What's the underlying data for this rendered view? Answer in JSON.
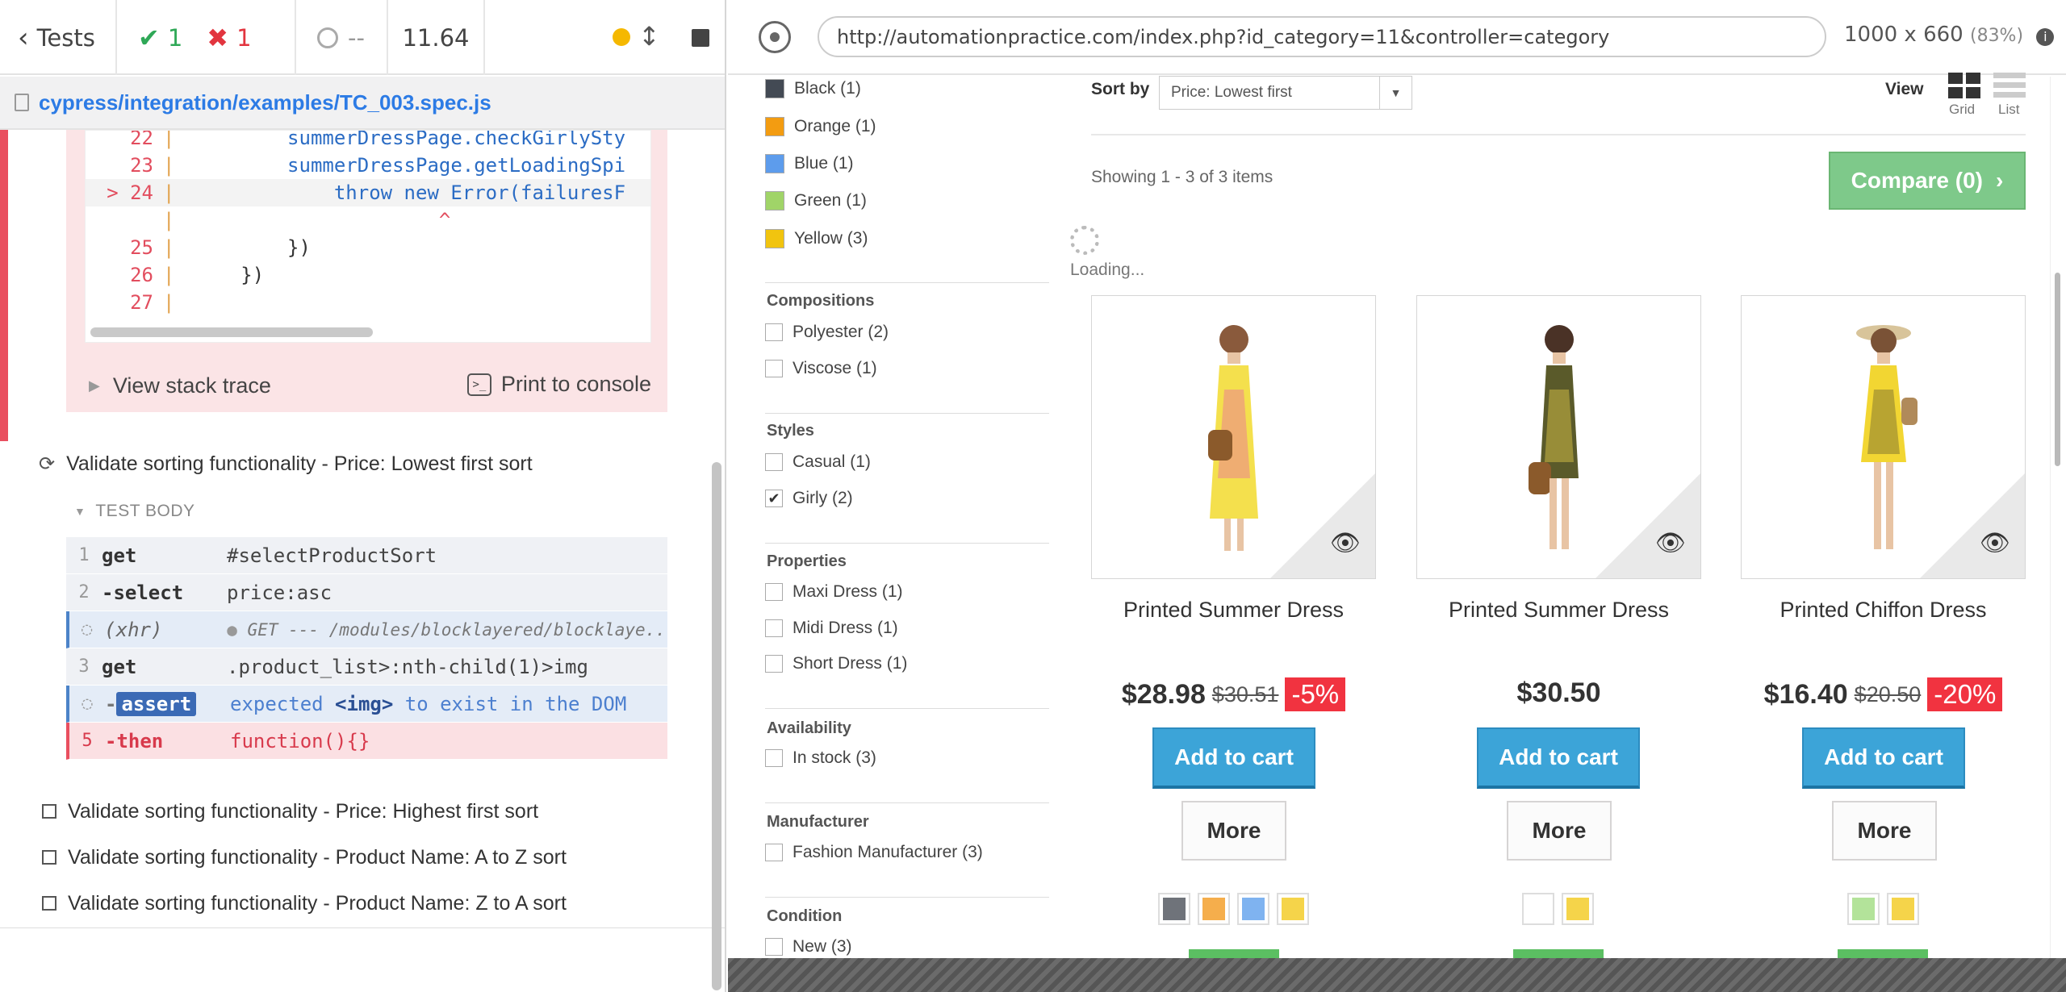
{
  "reporter": {
    "tests_label": "Tests",
    "passed": "1",
    "failed": "1",
    "pending": "--",
    "duration": "11.64",
    "spec_path": "cypress/integration/examples/TC_003.spec.js",
    "code_lines": [
      {
        "num": "22",
        "text": "summerDressPage.checkGirlySty"
      },
      {
        "num": "23",
        "text": "summerDressPage.getLoadingSpi"
      },
      {
        "num": "24",
        "prefix": ">",
        "text": "throw new Error(failuresF"
      },
      {
        "num": "",
        "text": "^"
      },
      {
        "num": "25",
        "text": "})"
      },
      {
        "num": "26",
        "text": "})"
      },
      {
        "num": "27",
        "text": ""
      }
    ],
    "view_stack_trace": "View stack trace",
    "print_to_console": "Print to console",
    "running_test": "Validate sorting functionality - Price: Lowest first sort",
    "test_body": "TEST BODY",
    "commands": [
      {
        "n": "1",
        "name": "get",
        "msg": "#selectProductSort"
      },
      {
        "n": "2",
        "name": "-select",
        "msg": "price:asc"
      },
      {
        "n": "",
        "name": "(xhr)",
        "msg": "GET --- /modules/blocklayered/blocklaye..."
      },
      {
        "n": "3",
        "name": "get",
        "msg": ".product_list>:nth-child(1)>img"
      },
      {
        "n": "",
        "name": "assert",
        "msg_pre": "expected ",
        "msg_tag": "<img>",
        "msg_post": " to exist in the DOM"
      },
      {
        "n": "5",
        "name": "-then",
        "msg": "function(){}"
      }
    ],
    "pending_tests": [
      "Validate sorting functionality - Price: Highest first sort",
      "Validate sorting functionality - Product Name: A to Z sort",
      "Validate sorting functionality - Product Name: Z to A sort"
    ]
  },
  "aut": {
    "url": "http://automationpractice.com/index.php?id_category=11&controller=category",
    "viewport": "1000 x 660",
    "scale": "(83%)",
    "colors": [
      {
        "label": "Black (1)",
        "hex": "#434a54"
      },
      {
        "label": "Orange (1)",
        "hex": "#f39c11"
      },
      {
        "label": "Blue (1)",
        "hex": "#5d9cec"
      },
      {
        "label": "Green (1)",
        "hex": "#a0d468"
      },
      {
        "label": "Yellow (3)",
        "hex": "#f1c40f"
      }
    ],
    "compositions_title": "Compositions",
    "compositions": [
      "Polyester (2)",
      "Viscose (1)"
    ],
    "styles_title": "Styles",
    "styles": [
      {
        "label": "Casual (1)",
        "checked": false
      },
      {
        "label": "Girly (2)",
        "checked": true
      }
    ],
    "properties_title": "Properties",
    "properties": [
      "Maxi Dress (1)",
      "Midi Dress (1)",
      "Short Dress (1)"
    ],
    "availability_title": "Availability",
    "availability": [
      "In stock (3)"
    ],
    "manufacturer_title": "Manufacturer",
    "manufacturer": [
      "Fashion Manufacturer (3)"
    ],
    "condition_title": "Condition",
    "condition": [
      "New (3)"
    ],
    "sort_label": "Sort by",
    "sort_value": "Price: Lowest first",
    "view_label": "View",
    "grid_label": "Grid",
    "list_label": "List",
    "showing": "Showing 1 - 3 of 3 items",
    "compare": "Compare (0)",
    "loading": "Loading...",
    "products": [
      {
        "name": "Printed Summer Dress",
        "price": "$28.98",
        "old_price": "$30.51",
        "discount": "-5%",
        "add": "Add to cart",
        "more": "More",
        "dress": "#f4e04d",
        "swatches": [
          "#6f737a",
          "#f5ae4c",
          "#7fb3f0",
          "#f5d44a"
        ]
      },
      {
        "name": "Printed Summer Dress",
        "price": "$30.50",
        "old_price": "",
        "discount": "",
        "add": "Add to cart",
        "more": "More",
        "dress": "#5a5a2a",
        "swatches": [
          "#ffffff",
          "#f5d44a"
        ]
      },
      {
        "name": "Printed Chiffon Dress",
        "price": "$16.40",
        "old_price": "$20.50",
        "discount": "-20%",
        "add": "Add to cart",
        "more": "More",
        "dress": "#f2d632",
        "swatches": [
          "#b3e39a",
          "#f5d44a"
        ]
      }
    ]
  }
}
